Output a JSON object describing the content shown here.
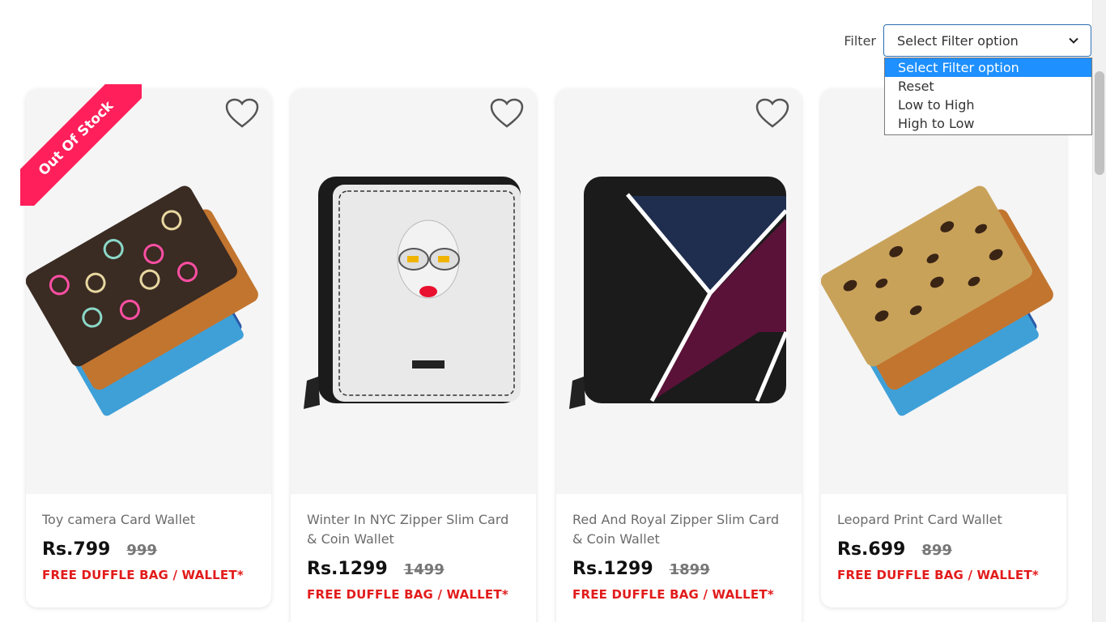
{
  "filter": {
    "label": "Filter",
    "selected": "Select Filter option",
    "options": [
      "Select Filter option",
      "Reset",
      "Low to High",
      "High to Low"
    ]
  },
  "products": [
    {
      "title": "Toy camera Card Wallet",
      "price": "Rs.799",
      "mrp": "999",
      "offer": "FREE DUFFLE BAG / WALLET*",
      "badge": "Out Of Stock"
    },
    {
      "title": "Winter In NYC Zipper Slim Card & Coin Wallet",
      "price": "Rs.1299",
      "mrp": "1499",
      "offer": "FREE DUFFLE BAG / WALLET*"
    },
    {
      "title": "Red And Royal Zipper Slim Card & Coin Wallet",
      "price": "Rs.1299",
      "mrp": "1899",
      "offer": "FREE DUFFLE BAG / WALLET*"
    },
    {
      "title": "Leopard Print Card Wallet",
      "price": "Rs.699",
      "mrp": "899",
      "offer": "FREE DUFFLE BAG / WALLET*"
    }
  ],
  "colors": {
    "accent": "#1e90ff",
    "offer": "#e21b1b",
    "ribbon": "#ff1f5a"
  },
  "icons": [
    "heart-icon",
    "chevron-down-icon"
  ]
}
